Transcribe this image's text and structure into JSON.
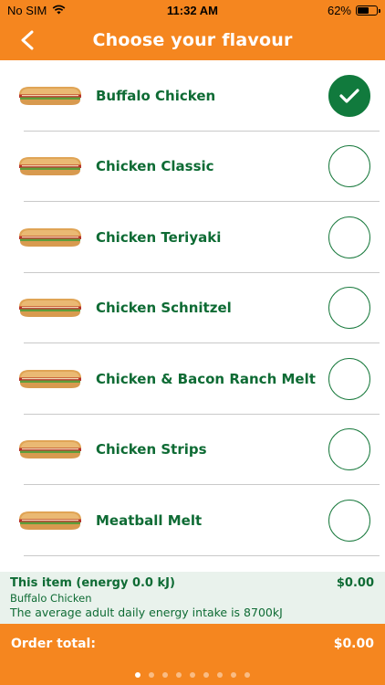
{
  "status": {
    "carrier": "No SIM",
    "time": "11:32 AM",
    "battery": "62%",
    "battery_level": 0.62
  },
  "header": {
    "title": "Choose your flavour"
  },
  "flavours": [
    {
      "name": "Buffalo Chicken",
      "selected": true
    },
    {
      "name": "Chicken Classic",
      "selected": false
    },
    {
      "name": "Chicken Teriyaki",
      "selected": false
    },
    {
      "name": "Chicken Schnitzel",
      "selected": false
    },
    {
      "name": "Chicken & Bacon Ranch Melt",
      "selected": false
    },
    {
      "name": "Chicken Strips",
      "selected": false
    },
    {
      "name": "Meatball Melt",
      "selected": false
    }
  ],
  "summary": {
    "item_label": "This item (energy 0.0 kJ)",
    "item_price": "$0.00",
    "item_name": "Buffalo Chicken",
    "note": "The average adult daily energy intake is 8700kJ"
  },
  "order": {
    "label": "Order total:",
    "total": "$0.00"
  },
  "pager": {
    "pages": 9,
    "active": 0
  },
  "colors": {
    "accent": "#f5861f",
    "brand_green": "#117a3d",
    "summary_bg": "#e9f2ec"
  }
}
